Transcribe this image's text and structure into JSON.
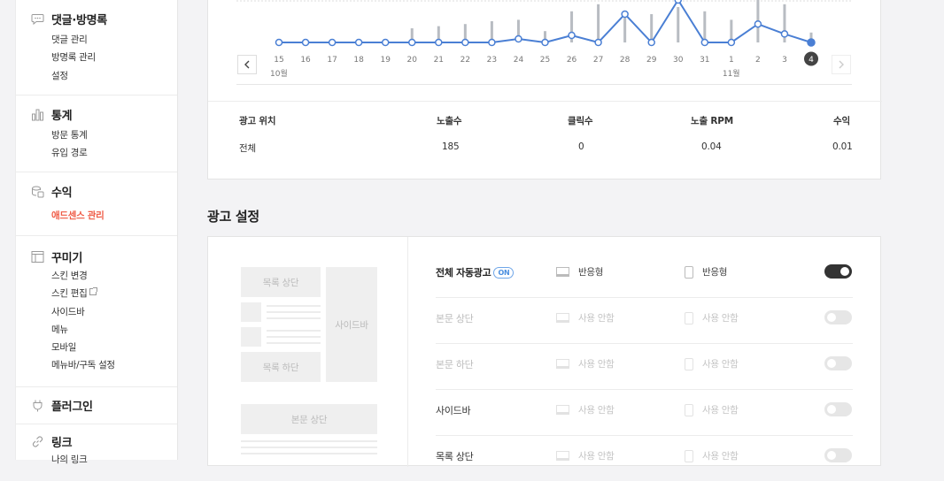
{
  "sidebar": {
    "groups": [
      {
        "title": "댓글·방명록",
        "icon": "comment-icon",
        "items": [
          "댓글 관리",
          "방명록 관리",
          "설정"
        ]
      },
      {
        "title": "통계",
        "icon": "bar-chart-icon",
        "items": [
          "방문 통계",
          "유입 경로"
        ]
      },
      {
        "title": "수익",
        "icon": "coins-icon",
        "items": [
          "애드센스 관리"
        ],
        "active_item": "애드센스 관리"
      },
      {
        "title": "꾸미기",
        "icon": "layout-icon",
        "items": [
          "스킨 변경",
          "스킨 편집",
          "사이드바",
          "메뉴",
          "모바일",
          "메뉴바/구독 설정"
        ]
      },
      {
        "title": "플러그인",
        "icon": "plug-icon",
        "items": []
      },
      {
        "title": "링크",
        "icon": "link-icon",
        "items": [
          "나의 링크"
        ]
      }
    ]
  },
  "chart": {
    "month_labels": [
      "10월",
      "11월"
    ],
    "selected_day": "4",
    "line_color": "#4a7fd4",
    "bar_color": "#b8bcc2"
  },
  "chart_data": {
    "type": "line",
    "categories": [
      "15",
      "16",
      "17",
      "18",
      "19",
      "20",
      "21",
      "22",
      "23",
      "24",
      "25",
      "26",
      "27",
      "28",
      "29",
      "30",
      "31",
      "1",
      "2",
      "3",
      "4"
    ],
    "series": [
      {
        "type": "line",
        "values": [
          0,
          0,
          0,
          0,
          0,
          0,
          0,
          0,
          0,
          0.5,
          0,
          1,
          0,
          4,
          0,
          6,
          0,
          0,
          2.6,
          1.2,
          0
        ]
      },
      {
        "type": "bar",
        "values": [
          0,
          0,
          0,
          0,
          0,
          2.0,
          2.3,
          2.6,
          3.0,
          3.2,
          1.6,
          4.4,
          5.4,
          4.0,
          4.0,
          5.0,
          4.4,
          3.2,
          6.0,
          5.4,
          1.4
        ]
      }
    ]
  },
  "ad_table": {
    "headers": [
      "광고 위치",
      "노출수",
      "클릭수",
      "노출 RPM",
      "수익"
    ],
    "rows": [
      [
        "전체",
        "185",
        "0",
        "0.04",
        "0.01"
      ]
    ]
  },
  "settings": {
    "title": "광고 설정",
    "preview": {
      "list_top": "목록 상단",
      "sidebar": "사이드바",
      "list_bottom": "목록 하단",
      "body_top": "본문 상단"
    },
    "on_badge": "ON",
    "rows": [
      {
        "label": "전체 자동광고",
        "pc": "반응형",
        "mobile": "반응형",
        "enabled": true
      },
      {
        "label": "본문 상단",
        "pc": "사용 안함",
        "mobile": "사용 안함",
        "enabled": false
      },
      {
        "label": "본문 하단",
        "pc": "사용 안함",
        "mobile": "사용 안함",
        "enabled": false
      },
      {
        "label": "사이드바",
        "pc": "사용 안함",
        "mobile": "사용 안함",
        "enabled": false
      },
      {
        "label": "목록 상단",
        "pc": "사용 안함",
        "mobile": "사용 안함",
        "enabled": false
      }
    ]
  }
}
